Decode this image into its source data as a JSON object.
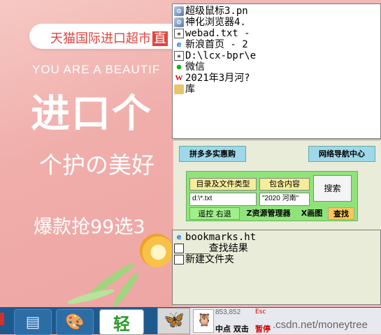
{
  "background_ad": {
    "brand": "天猫国际进口超市",
    "brand_tail": "直",
    "slogan_en": "YOU ARE A BEAUTIF",
    "headline": "进口个",
    "subline": "个护の美好",
    "sale": "爆款抢99选3"
  },
  "top_list": {
    "items": [
      {
        "icon": "exe-icon",
        "label": "超级鼠标3.pn"
      },
      {
        "icon": "exe-icon",
        "label": "神化浏览器4."
      },
      {
        "icon": "text-file-icon",
        "label": "webad.txt -"
      },
      {
        "icon": "ie-icon",
        "label": "新浪首页 - 2"
      },
      {
        "icon": "text-file-icon",
        "label": "D:\\lcx-bpr\\e"
      },
      {
        "icon": "wechat-icon",
        "label": "微信"
      },
      {
        "icon": "wps-icon",
        "label": "2021年3月河?"
      },
      {
        "icon": "library-icon",
        "label": "库"
      }
    ]
  },
  "control_panel": {
    "pdd_button": "拼多多实惠购",
    "nav_button": "网络导航中心",
    "dir_type_button": "目录及文件类型",
    "contains_button": "包含内容",
    "search_button": "搜索",
    "path_value": "d:\\*.txt",
    "content_value": "\"2020 河南\"",
    "tabs": [
      "遥控 右退",
      "Z资源管理器",
      "X画图",
      "查找"
    ]
  },
  "bottom_list": {
    "items": [
      {
        "icon": "ie-icon",
        "label": "bookmarks.ht"
      },
      {
        "icon": "folder-icon",
        "label": "____查找结果"
      },
      {
        "icon": "folder-icon",
        "label": "新建文件夹"
      }
    ]
  },
  "taskbar": {
    "qing_label": "轻",
    "coords": "853,852",
    "esc_label": "Esc",
    "midpoint_label": "中点 双击",
    "pause_label": "暂停",
    "watermark": ".csdn.net/moneytree"
  },
  "colors": {
    "accent_blue": "#1f5a8e",
    "panel_green": "#8fe37a",
    "button_cyan": "#9fd8e8",
    "alert_red": "#d00000"
  }
}
